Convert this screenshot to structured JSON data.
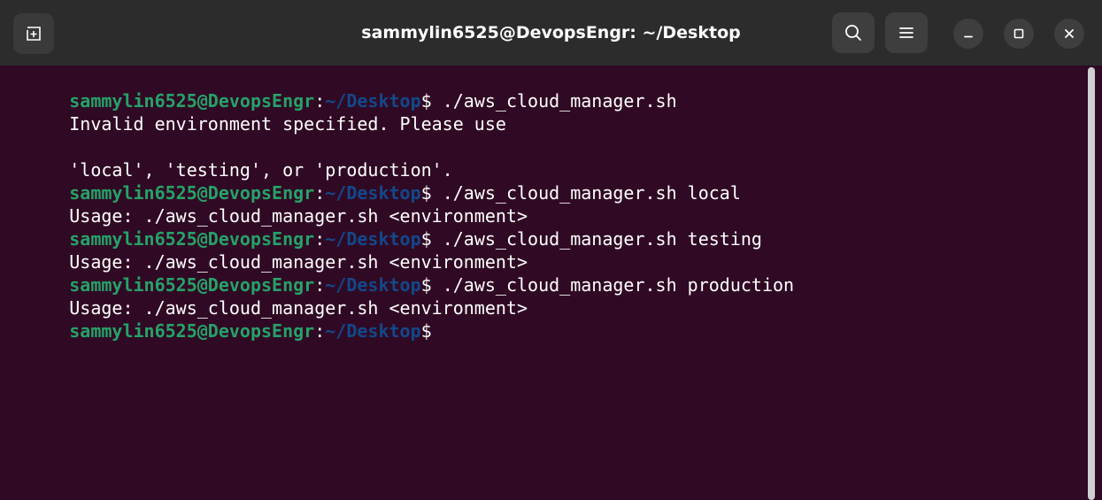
{
  "window": {
    "title": "sammylin6525@DevopsEngr: ~/Desktop",
    "colors": {
      "titlebar_bg": "#2c2c2c",
      "terminal_bg": "#300a24",
      "prompt_user": "#26a269",
      "prompt_path": "#12488b",
      "text": "#ffffff"
    },
    "icons": {
      "new_tab": "new-tab-icon",
      "search": "search-icon",
      "menu": "hamburger-menu-icon",
      "minimize": "minimize-icon",
      "maximize": "maximize-icon",
      "close": "close-icon"
    }
  },
  "terminal": {
    "prompt": {
      "user_host": "sammylin6525@DevopsEngr",
      "colon": ":",
      "path": "~/Desktop",
      "symbol": "$"
    },
    "lines": [
      {
        "type": "prompt",
        "command": " ./aws_cloud_manager.sh"
      },
      {
        "type": "output",
        "text": "Invalid environment specified. Please use"
      },
      {
        "type": "output",
        "text": ""
      },
      {
        "type": "output",
        "text": "'local', 'testing', or 'production'."
      },
      {
        "type": "prompt",
        "command": " ./aws_cloud_manager.sh local"
      },
      {
        "type": "output",
        "text": "Usage: ./aws_cloud_manager.sh <environment>"
      },
      {
        "type": "prompt",
        "command": " ./aws_cloud_manager.sh testing"
      },
      {
        "type": "output",
        "text": "Usage: ./aws_cloud_manager.sh <environment>"
      },
      {
        "type": "prompt",
        "command": " ./aws_cloud_manager.sh production"
      },
      {
        "type": "output",
        "text": "Usage: ./aws_cloud_manager.sh <environment>"
      },
      {
        "type": "prompt",
        "command": ""
      }
    ]
  }
}
